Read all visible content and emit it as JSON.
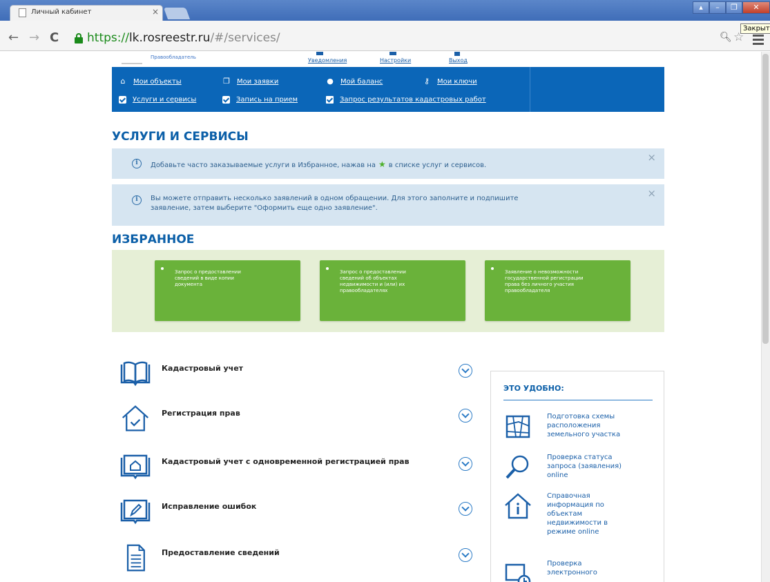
{
  "browser": {
    "tab_title": "Личный кабинет",
    "tab_close": "×",
    "tooltip": "Закрыть",
    "url_scheme": "https://",
    "url_host": "lk.rosreestr.ru",
    "url_path": "/#/services/"
  },
  "top_strip": {
    "owner_label": "Правообладатель",
    "links": [
      "Уведомления",
      "Настройки",
      "Выход"
    ]
  },
  "nav": {
    "row1": [
      {
        "label": "Мои объекты",
        "icon": "home-icon"
      },
      {
        "label": "Мои заявки",
        "icon": "copy-icon"
      },
      {
        "label": "Мой баланс",
        "icon": "balance-icon"
      },
      {
        "label": "Мои ключи",
        "icon": "key-icon"
      }
    ],
    "row2": [
      {
        "label": "Услуги и сервисы",
        "icon": "checkbox-icon"
      },
      {
        "label": "Запись на прием",
        "icon": "checkbox-icon"
      },
      {
        "label": "Запрос результатов кадастровых работ",
        "icon": "document-icon"
      }
    ]
  },
  "services_title": "УСЛУГИ И СЕРВИСЫ",
  "notices": [
    {
      "text_before": "Добавьте часто заказываемые услуги в Избранное, нажав на",
      "text_after": "в списке услуг и сервисов."
    },
    {
      "line1": "Вы можете отправить несколько заявлений в одном обращении. Для этого заполните и подпишите",
      "line2": "заявление, затем выберите \"Оформить еще одно заявление\"."
    }
  ],
  "favorites_title": "ИЗБРАННОЕ",
  "favorites": [
    {
      "lines": [
        "Запрос о предоставлении",
        "сведений в виде копии",
        "документа"
      ]
    },
    {
      "lines": [
        "Запрос о предоставлении",
        "сведений об объектах",
        "недвижимости и (или) их",
        "правообладателях"
      ]
    },
    {
      "lines": [
        "Заявление о невозможности",
        "государственной регистрации",
        "права без личного участия",
        "правообладателя"
      ]
    }
  ],
  "services": [
    {
      "label": "Кадастровый учет",
      "icon": "open-book-icon"
    },
    {
      "label": "Регистрация прав",
      "icon": "house-check-icon"
    },
    {
      "label": "Кадастровый учет с одновременной регистрацией прав",
      "icon": "book-house-icon"
    },
    {
      "label": "Исправление ошибок",
      "icon": "book-pencil-icon"
    },
    {
      "label": "Предоставление сведений",
      "icon": "document-lines-icon"
    }
  ],
  "convenient": {
    "title": "ЭТО УДОБНО:",
    "items": [
      {
        "lines": [
          "Подготовка схемы",
          "расположения",
          "земельного участка"
        ],
        "icon": "map-scheme-icon"
      },
      {
        "lines": [
          "Проверка статуса",
          "запроса (заявления)",
          "online"
        ],
        "icon": "magnifier-icon"
      },
      {
        "lines": [
          "Справочная",
          "информация по",
          "объектам",
          "недвижимости в",
          "режиме online"
        ],
        "icon": "house-info-icon"
      },
      {
        "lines": [
          "Проверка",
          "электронного"
        ],
        "icon": "monitor-clock-icon"
      }
    ]
  }
}
